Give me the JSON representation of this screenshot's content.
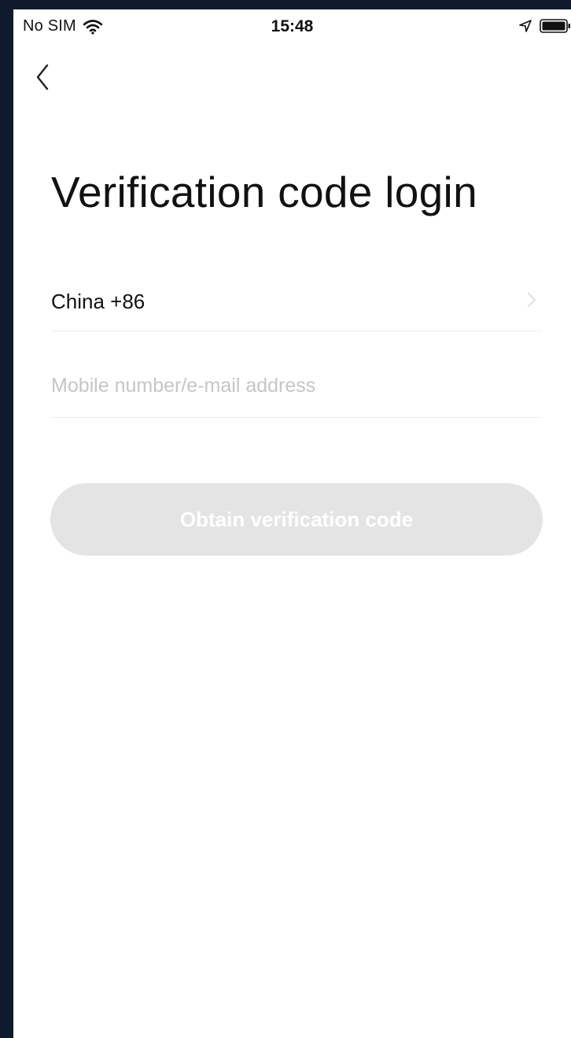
{
  "status_bar": {
    "carrier": "No SIM",
    "time": "15:48",
    "icons": [
      "wifi-icon",
      "location-icon",
      "battery-icon"
    ]
  },
  "nav": {
    "back_icon": "chevron-left-icon"
  },
  "page": {
    "title": "Verification code login"
  },
  "form": {
    "country_label": "China +86",
    "country_chevron_icon": "chevron-right-icon",
    "mobile_value": "",
    "mobile_placeholder": "Mobile number/e-mail address",
    "obtain_button_label": "Obtain verification code"
  },
  "colors": {
    "frame": "#0f1a2e",
    "button_disabled_bg": "#e4e4e4",
    "placeholder": "#c6c6c6",
    "divider": "#ececec"
  }
}
